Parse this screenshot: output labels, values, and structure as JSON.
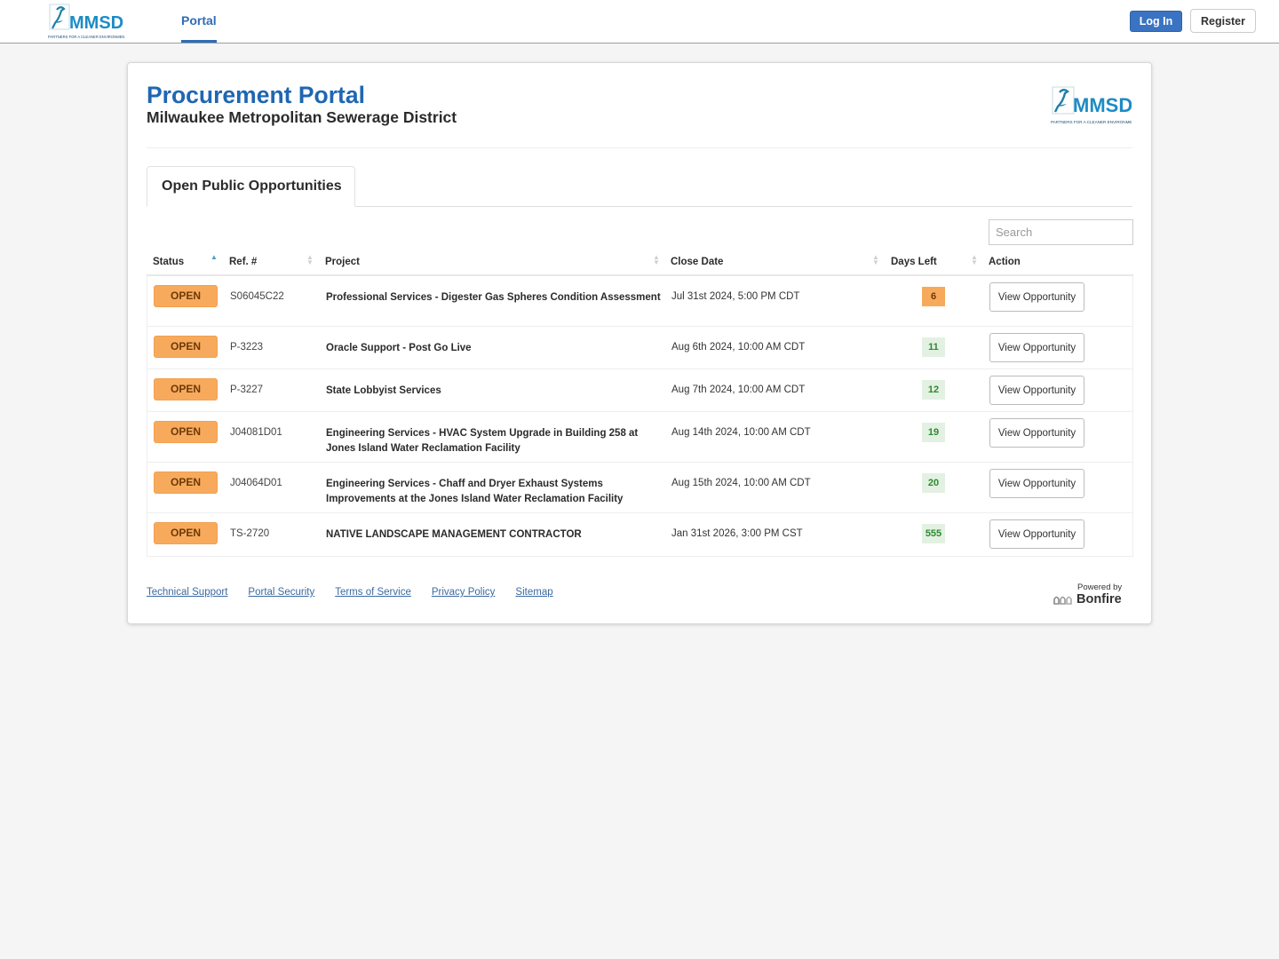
{
  "nav": {
    "logo_text": "MMSD",
    "logo_tagline": "PARTNERS FOR A CLEANER ENVIRONMENT",
    "tab_label": "Portal",
    "login_label": "Log In",
    "register_label": "Register"
  },
  "header": {
    "title": "Procurement Portal",
    "subtitle": "Milwaukee Metropolitan Sewerage District"
  },
  "tabs": [
    {
      "label": "Open Public Opportunities",
      "active": true
    }
  ],
  "search": {
    "placeholder": "Search",
    "value": ""
  },
  "table": {
    "columns": [
      {
        "label": "Status",
        "sort": "asc"
      },
      {
        "label": "Ref. #",
        "sort": "none"
      },
      {
        "label": "Project",
        "sort": "none"
      },
      {
        "label": "Close Date",
        "sort": "none"
      },
      {
        "label": "Days Left",
        "sort": "none"
      },
      {
        "label": "Action",
        "sort": null
      }
    ],
    "rows": [
      {
        "status": "OPEN",
        "ref": "S06045C22",
        "project": "Professional Services - Digester Gas Spheres Condition Assessment",
        "close_date": "Jul 31st 2024, 5:00 PM CDT",
        "days_left": "6",
        "days_level": "warn",
        "action": "View Opportunity"
      },
      {
        "status": "OPEN",
        "ref": "P-3223",
        "project": "Oracle Support - Post Go Live",
        "close_date": "Aug 6th 2024, 10:00 AM CDT",
        "days_left": "11",
        "days_level": "ok",
        "action": "View Opportunity"
      },
      {
        "status": "OPEN",
        "ref": "P-3227",
        "project": "State Lobbyist Services",
        "close_date": "Aug 7th 2024, 10:00 AM CDT",
        "days_left": "12",
        "days_level": "ok",
        "action": "View Opportunity"
      },
      {
        "status": "OPEN",
        "ref": "J04081D01",
        "project": "Engineering Services - HVAC System Upgrade in Building 258 at Jones Island Water Reclamation Facility",
        "close_date": "Aug 14th 2024, 10:00 AM CDT",
        "days_left": "19",
        "days_level": "ok",
        "action": "View Opportunity"
      },
      {
        "status": "OPEN",
        "ref": "J04064D01",
        "project": "Engineering Services - Chaff and Dryer Exhaust Systems Improvements at the Jones Island Water Reclamation Facility",
        "close_date": "Aug 15th 2024, 10:00 AM CDT",
        "days_left": "20",
        "days_level": "ok",
        "action": "View Opportunity"
      },
      {
        "status": "OPEN",
        "ref": "TS-2720",
        "project": "NATIVE LANDSCAPE MANAGEMENT CONTRACTOR",
        "close_date": "Jan 31st 2026, 3:00 PM CST",
        "days_left": "555",
        "days_level": "ok",
        "action": "View Opportunity"
      }
    ]
  },
  "footer": {
    "links": [
      "Technical Support",
      "Portal Security",
      "Terms of Service",
      "Privacy Policy",
      "Sitemap"
    ],
    "powered_by": "Powered by",
    "brand": "Bonfire"
  },
  "colors": {
    "brand_blue": "#1f67b1",
    "status_open": "#f8aa5c",
    "days_ok_bg": "#e3f1e3",
    "days_ok_text": "#2d8a2d"
  }
}
